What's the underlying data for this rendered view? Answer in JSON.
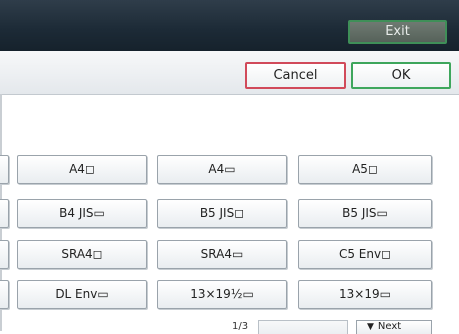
{
  "header": {
    "exit_label": "Exit"
  },
  "actions": {
    "cancel_label": "Cancel",
    "ok_label": "OK"
  },
  "paper_sizes": {
    "rows": [
      {
        "partial": "",
        "items": [
          "A4◻",
          "A4▭",
          "A5◻"
        ]
      },
      {
        "partial": "",
        "items": [
          "B4 JIS▭",
          "B5 JIS◻",
          "B5 JIS▭"
        ]
      },
      {
        "partial": "",
        "items": [
          "SRA4◻",
          "SRA4▭",
          "C5 Env◻"
        ]
      },
      {
        "partial": "",
        "items": [
          "DL Env▭",
          "13×19½▭",
          "13×19▭"
        ]
      }
    ]
  },
  "pager": {
    "page_indicator": "1/3",
    "prev_label": "",
    "next_label": "Next"
  }
}
